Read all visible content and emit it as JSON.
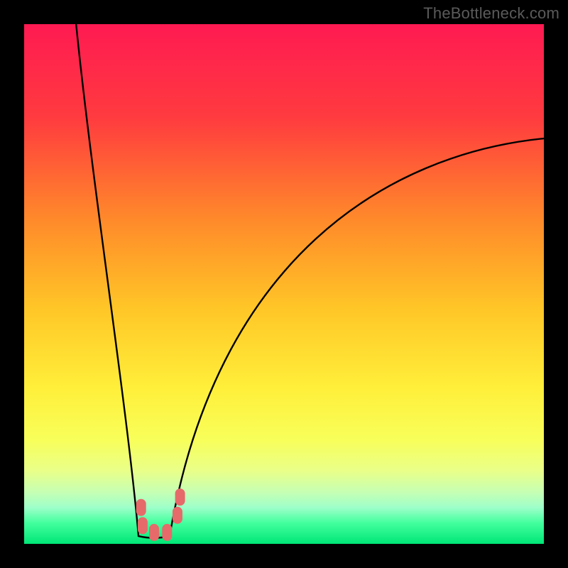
{
  "watermark": "TheBottleneck.com",
  "chart_data": {
    "type": "line",
    "title": "",
    "xlabel": "",
    "ylabel": "",
    "xlim": [
      0,
      100
    ],
    "ylim": [
      0,
      100
    ],
    "curve": {
      "min_x": 25,
      "left_start_x": 10,
      "left_start_y": 100,
      "right_end_x": 100,
      "right_end_y": 78,
      "trough_width": 6
    },
    "gradient_stops": [
      {
        "offset": 0,
        "color": "#ff1a52"
      },
      {
        "offset": 18,
        "color": "#ff3b3f"
      },
      {
        "offset": 38,
        "color": "#ff8b2a"
      },
      {
        "offset": 55,
        "color": "#ffc727"
      },
      {
        "offset": 70,
        "color": "#ffef3a"
      },
      {
        "offset": 80,
        "color": "#f8ff5a"
      },
      {
        "offset": 86,
        "color": "#e9ff89"
      },
      {
        "offset": 90,
        "color": "#c7ffb3"
      },
      {
        "offset": 93,
        "color": "#9effc9"
      },
      {
        "offset": 96,
        "color": "#42ff9e"
      },
      {
        "offset": 100,
        "color": "#00e676"
      }
    ],
    "markers": [
      {
        "x": 22.5,
        "y": 7.0
      },
      {
        "x": 22.8,
        "y": 3.5
      },
      {
        "x": 25.0,
        "y": 2.2
      },
      {
        "x": 27.5,
        "y": 2.2
      },
      {
        "x": 29.5,
        "y": 5.5
      },
      {
        "x": 30.0,
        "y": 9.0
      }
    ],
    "marker_color": "#e66a6a",
    "curve_color": "#000000"
  }
}
